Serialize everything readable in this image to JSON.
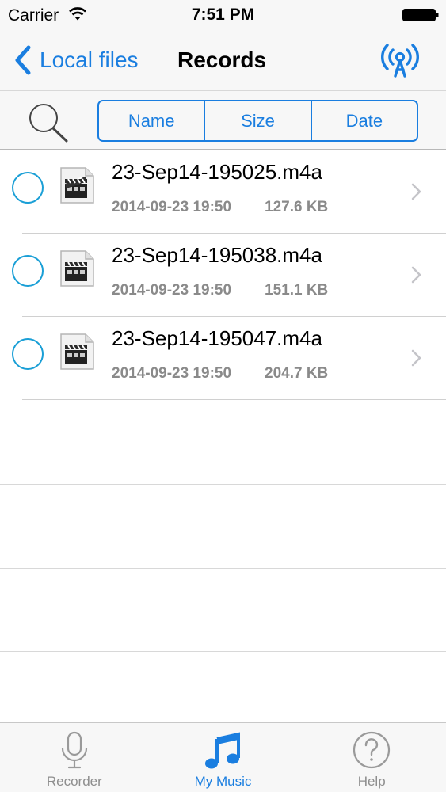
{
  "status_bar": {
    "carrier": "Carrier",
    "time": "7:51 PM"
  },
  "nav": {
    "back_label": "Local files",
    "title": "Records"
  },
  "sort": {
    "segments": [
      "Name",
      "Size",
      "Date"
    ]
  },
  "files": [
    {
      "name": "23-Sep14-195025.m4a",
      "date": "2014-09-23 19:50",
      "size": "127.6 KB"
    },
    {
      "name": "23-Sep14-195038.m4a",
      "date": "2014-09-23 19:50",
      "size": "151.1 KB"
    },
    {
      "name": "23-Sep14-195047.m4a",
      "date": "2014-09-23 19:50",
      "size": "204.7 KB"
    }
  ],
  "tabs": [
    {
      "label": "Recorder",
      "icon": "microphone-icon",
      "active": false
    },
    {
      "label": "My Music",
      "icon": "music-note-icon",
      "active": true
    },
    {
      "label": "Help",
      "icon": "help-icon",
      "active": false
    }
  ],
  "colors": {
    "accent": "#1a7ee0",
    "select_circle": "#1a9fd6",
    "secondary_text": "#8a8a8a"
  }
}
